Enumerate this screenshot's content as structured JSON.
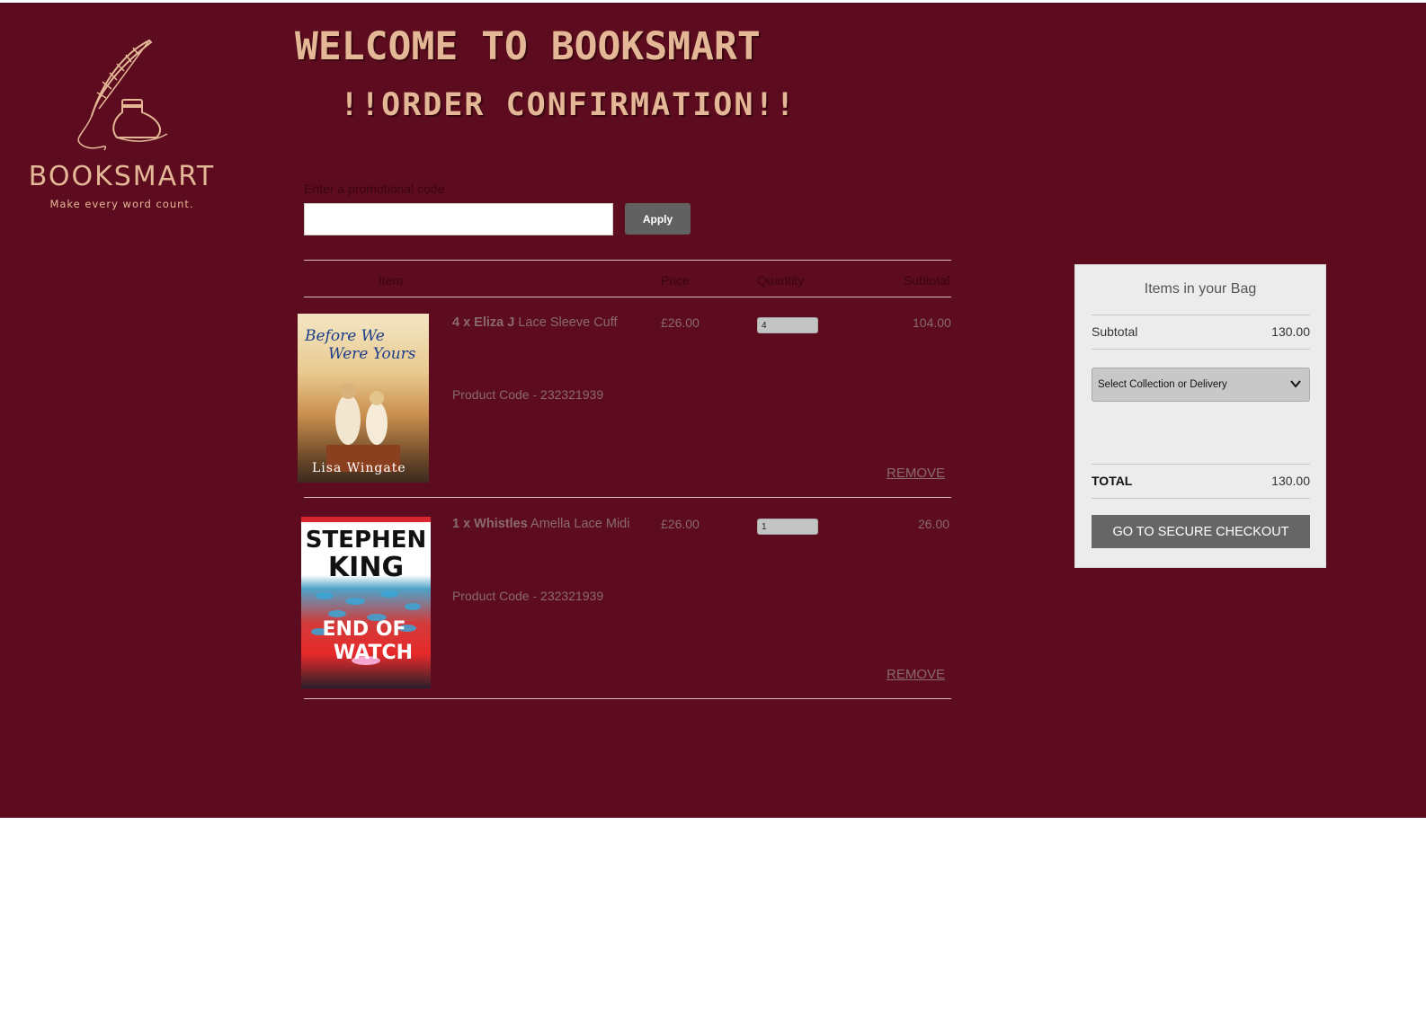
{
  "brand": {
    "logo_text": "BOOKSMART",
    "tagline": "Make every word count."
  },
  "header": {
    "welcome": "WELCOME TO BOOKSMART",
    "confirmation": "!!ORDER CONFIRMATION!!"
  },
  "promo": {
    "label": "Enter a promotional code",
    "value": "",
    "apply_label": "Apply"
  },
  "table": {
    "headers": {
      "item": "Item",
      "price": "Price",
      "quantity": "Quantity",
      "subtotal": "Subtotal"
    }
  },
  "items": [
    {
      "qty_brand": "4 x Eliza J",
      "name": "Lace Sleeve Cuff",
      "price": "£26.00",
      "quantity": "4",
      "subtotal": "104.00",
      "product_code": "Product Code - 232321939",
      "remove": "REMOVE",
      "cover": {
        "title_line1": "Before We",
        "title_line2": "Were Yours",
        "author": "Lisa Wingate"
      }
    },
    {
      "qty_brand": "1 x Whistles",
      "name": "Amella Lace Midi",
      "price": "£26.00",
      "quantity": "1",
      "subtotal": "26.00",
      "product_code": "Product Code - 232321939",
      "remove": "REMOVE",
      "cover": {
        "author_line1": "STEPHEN",
        "author_line2": "KING",
        "title_line1": "END OF",
        "title_line2": "WATCH"
      }
    }
  ],
  "bag": {
    "title": "Items in your Bag",
    "subtotal_label": "Subtotal",
    "subtotal_value": "130.00",
    "delivery_select": "Select Collection or Delivery",
    "total_label": "TOTAL",
    "total_value": "130.00",
    "checkout_label": "GO TO SECURE CHECKOUT"
  },
  "colors": {
    "background": "#5c0c1e",
    "accent": "#e4b896",
    "button": "#616161"
  }
}
